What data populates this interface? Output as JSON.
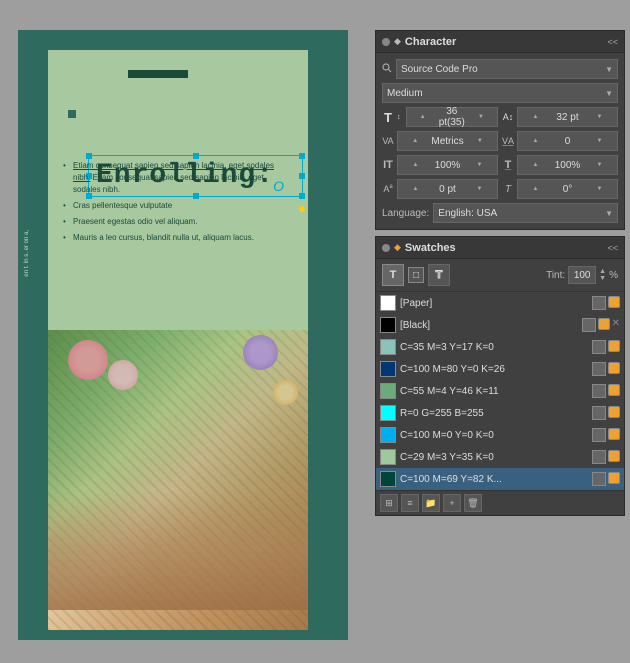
{
  "app": {
    "bg_color": "#9e9e9e"
  },
  "document": {
    "bg_color": "#2e6b5e",
    "page_bg": "#f0f0f0",
    "green_section_color": "#a8c8a0",
    "dark_bar_color": "#1a4a3a",
    "title": "Enrolling:",
    "content_bullets": [
      "Etiam consequat sapien sed sapien lacinia, eget sodales nibh.",
      "Cras pellentesque vulputate",
      "Praesent egestas odio vel aliquam.",
      "Mauris a leo cursus, blandit nulla ut, aliquam lacus."
    ]
  },
  "character_panel": {
    "title": "Character",
    "font_family": "Source Code Pro",
    "font_style": "Medium",
    "font_size": "36 pt(35)",
    "leading": "32 pt",
    "kerning": "Metrics",
    "tracking": "0",
    "horizontal_scale": "100%",
    "vertical_scale": "100%",
    "baseline_shift": "0 pt",
    "skew": "0°",
    "language": "English: USA",
    "close_label": "×",
    "collapse_label": "<<"
  },
  "swatches_panel": {
    "title": "Swatches",
    "tint_label": "Tint:",
    "tint_value": "100",
    "tint_percent": "%",
    "close_label": "×",
    "collapse_label": "<<",
    "swatches": [
      {
        "name": "[Paper]",
        "color": "#ffffff",
        "selected": false
      },
      {
        "name": "[Black]",
        "color": "#000000",
        "selected": false,
        "has_delete": true
      },
      {
        "name": "C=35 M=3 Y=17 K=0",
        "color": "#89c4bb",
        "selected": false
      },
      {
        "name": "C=100 M=80 Y=0 K=26",
        "color": "#003875",
        "selected": false
      },
      {
        "name": "C=55 M=4 Y=46 K=11",
        "color": "#6aab7a",
        "selected": false
      },
      {
        "name": "R=0 G=255 B=255",
        "color": "#00ffff",
        "selected": false
      },
      {
        "name": "C=100 M=0 Y=0 K=0",
        "color": "#00aeef",
        "selected": false
      },
      {
        "name": "C=29 M=3 Y=35 K=0",
        "color": "#9dc99d",
        "selected": false
      },
      {
        "name": "C=100 M=69 Y=82 K...",
        "color": "#00443a",
        "selected": true
      }
    ],
    "footer_buttons": [
      "grid-icon",
      "list-icon",
      "folder-icon",
      "add-icon",
      "delete-icon"
    ]
  }
}
